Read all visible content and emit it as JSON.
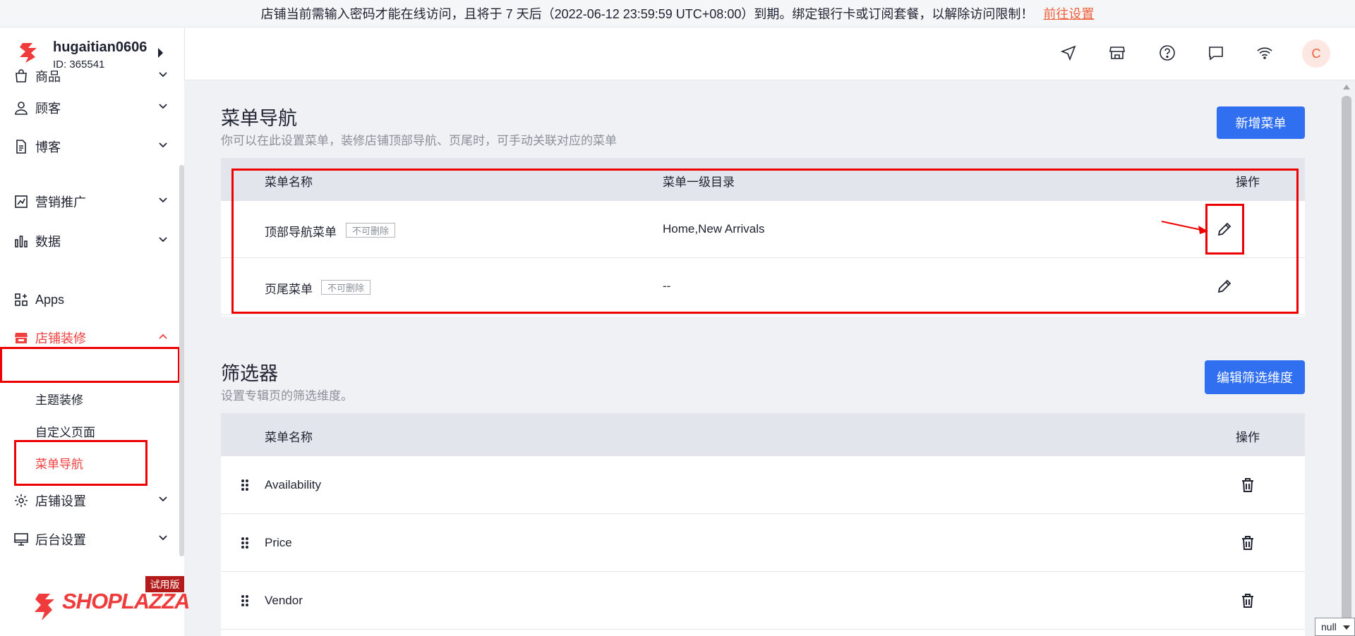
{
  "banner": {
    "text": "店铺当前需输入密码才能在线访问，且将于 7 天后（2022-06-12 23:59:59 UTC+08:00）到期。绑定银行卡或订阅套餐，以解除访问限制！",
    "link": "前往设置"
  },
  "store": {
    "name": "hugaitian0606",
    "id": "ID: 365541"
  },
  "nav": [
    {
      "label": "商品",
      "icon": "shopping-bag-icon"
    },
    {
      "label": "顾客",
      "icon": "user-icon"
    },
    {
      "label": "博客",
      "icon": "document-icon"
    },
    {
      "label": "营销推广",
      "icon": "marketing-icon"
    },
    {
      "label": "数据",
      "icon": "bar-chart-icon"
    },
    {
      "label": "Apps",
      "icon": "apps-icon"
    },
    {
      "label": "店铺装修",
      "icon": "storefront-icon"
    },
    {
      "label": "店铺设置",
      "icon": "gear-icon"
    },
    {
      "label": "后台设置",
      "icon": "monitor-icon"
    }
  ],
  "subnav": [
    {
      "label": "主题装修"
    },
    {
      "label": "自定义页面"
    },
    {
      "label": "菜单导航"
    }
  ],
  "brand": {
    "trial": "试用版",
    "logo_text": "SHOPLAZZA"
  },
  "avatar": "C",
  "menu_section": {
    "title": "菜单导航",
    "desc": "你可以在此设置菜单，装修店铺顶部导航、页尾时，可手动关联对应的菜单",
    "add_button": "新增菜单",
    "columns": [
      "菜单名称",
      "菜单一级目录",
      "操作"
    ],
    "rows": [
      {
        "name": "顶部导航菜单",
        "tag": "不可删除",
        "dir": "Home,New Arrivals"
      },
      {
        "name": "页尾菜单",
        "tag": "不可删除",
        "dir": "--"
      }
    ]
  },
  "filter_section": {
    "title": "筛选器",
    "desc": "设置专辑页的筛选维度。",
    "edit_button": "编辑筛选维度",
    "columns": [
      "菜单名称",
      "操作"
    ],
    "rows": [
      {
        "name": "Availability"
      },
      {
        "name": "Price"
      },
      {
        "name": "Vendor"
      }
    ]
  },
  "select_value": "null",
  "colors": {
    "accent": "#2f6ff0",
    "active": "#f04040",
    "highlight": "#ee0000",
    "warning_link": "#f0603c"
  }
}
